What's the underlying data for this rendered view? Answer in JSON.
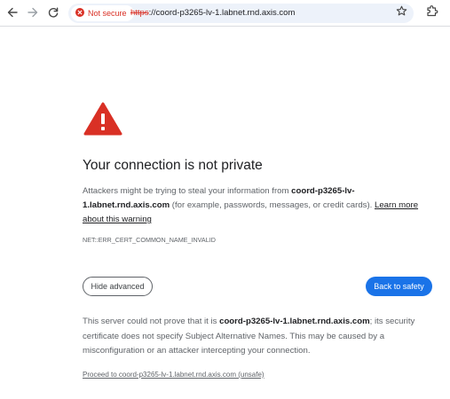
{
  "browser": {
    "security_chip": {
      "label": "Not secure",
      "color": "#d93025"
    },
    "url": {
      "scheme": "https",
      "separator": "://",
      "host": "coord-p3265-lv-1.labnet.rnd.axis.com"
    },
    "icons": {
      "back": "arrow-left-icon",
      "forward": "arrow-right-icon",
      "reload": "reload-icon",
      "bookmark": "star-icon",
      "extensions": "puzzle-icon"
    }
  },
  "interstitial": {
    "icon": "warning-triangle-icon",
    "icon_color": "#d93025",
    "heading": "Your connection is not private",
    "explanation": {
      "prefix": "Attackers might be trying to steal your information from ",
      "host": "coord-p3265-lv-1.labnet.rnd.axis.com",
      "suffix": " (for example, passwords, messages, or credit cards). ",
      "learn_more": "Learn more about this warning"
    },
    "error_code": "NET::ERR_CERT_COMMON_NAME_INVALID",
    "buttons": {
      "advanced": "Hide advanced",
      "safety": "Back to safety",
      "safety_color": "#1a73e8"
    },
    "details": {
      "prefix": "This server could not prove that it is ",
      "host": "coord-p3265-lv-1.labnet.rnd.axis.com",
      "suffix": "; its security certificate does not specify Subject Alternative Names. This may be caused by a misconfiguration or an attacker intercepting your connection."
    },
    "proceed_link": "Proceed to coord-p3265-lv-1.labnet.rnd.axis.com (unsafe)"
  }
}
